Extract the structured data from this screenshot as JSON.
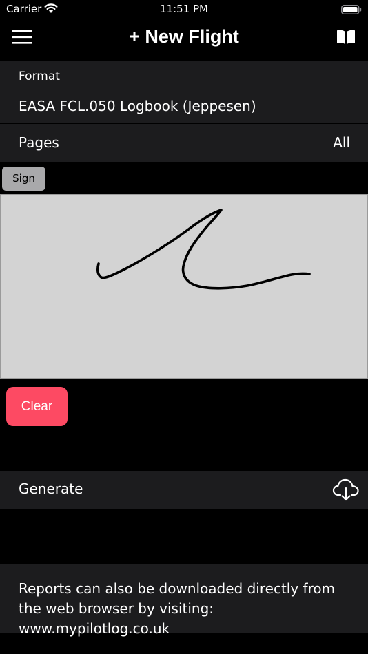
{
  "status_bar": {
    "carrier": "Carrier",
    "time": "11:51 PM",
    "icons": [
      "wifi-icon",
      "battery-icon"
    ]
  },
  "nav": {
    "title": "+ New Flight",
    "left_icon": "menu-icon",
    "right_icon": "book-icon"
  },
  "format": {
    "label": "Format",
    "value": "EASA FCL.050 Logbook (Jeppesen)"
  },
  "pages": {
    "label": "Pages",
    "value": "All"
  },
  "signature": {
    "sign_label": "Sign",
    "clear_label": "Clear",
    "pad_color": "#d3d3d3"
  },
  "generate": {
    "label": "Generate",
    "icon": "cloud-download-icon"
  },
  "info": {
    "text": "Reports can also be downloaded directly from the web browser by visiting: www.mypilotlog.co.uk"
  },
  "colors": {
    "background": "#000000",
    "row_background": "#1c1c1e",
    "accent_clear": "#fd4a63"
  }
}
